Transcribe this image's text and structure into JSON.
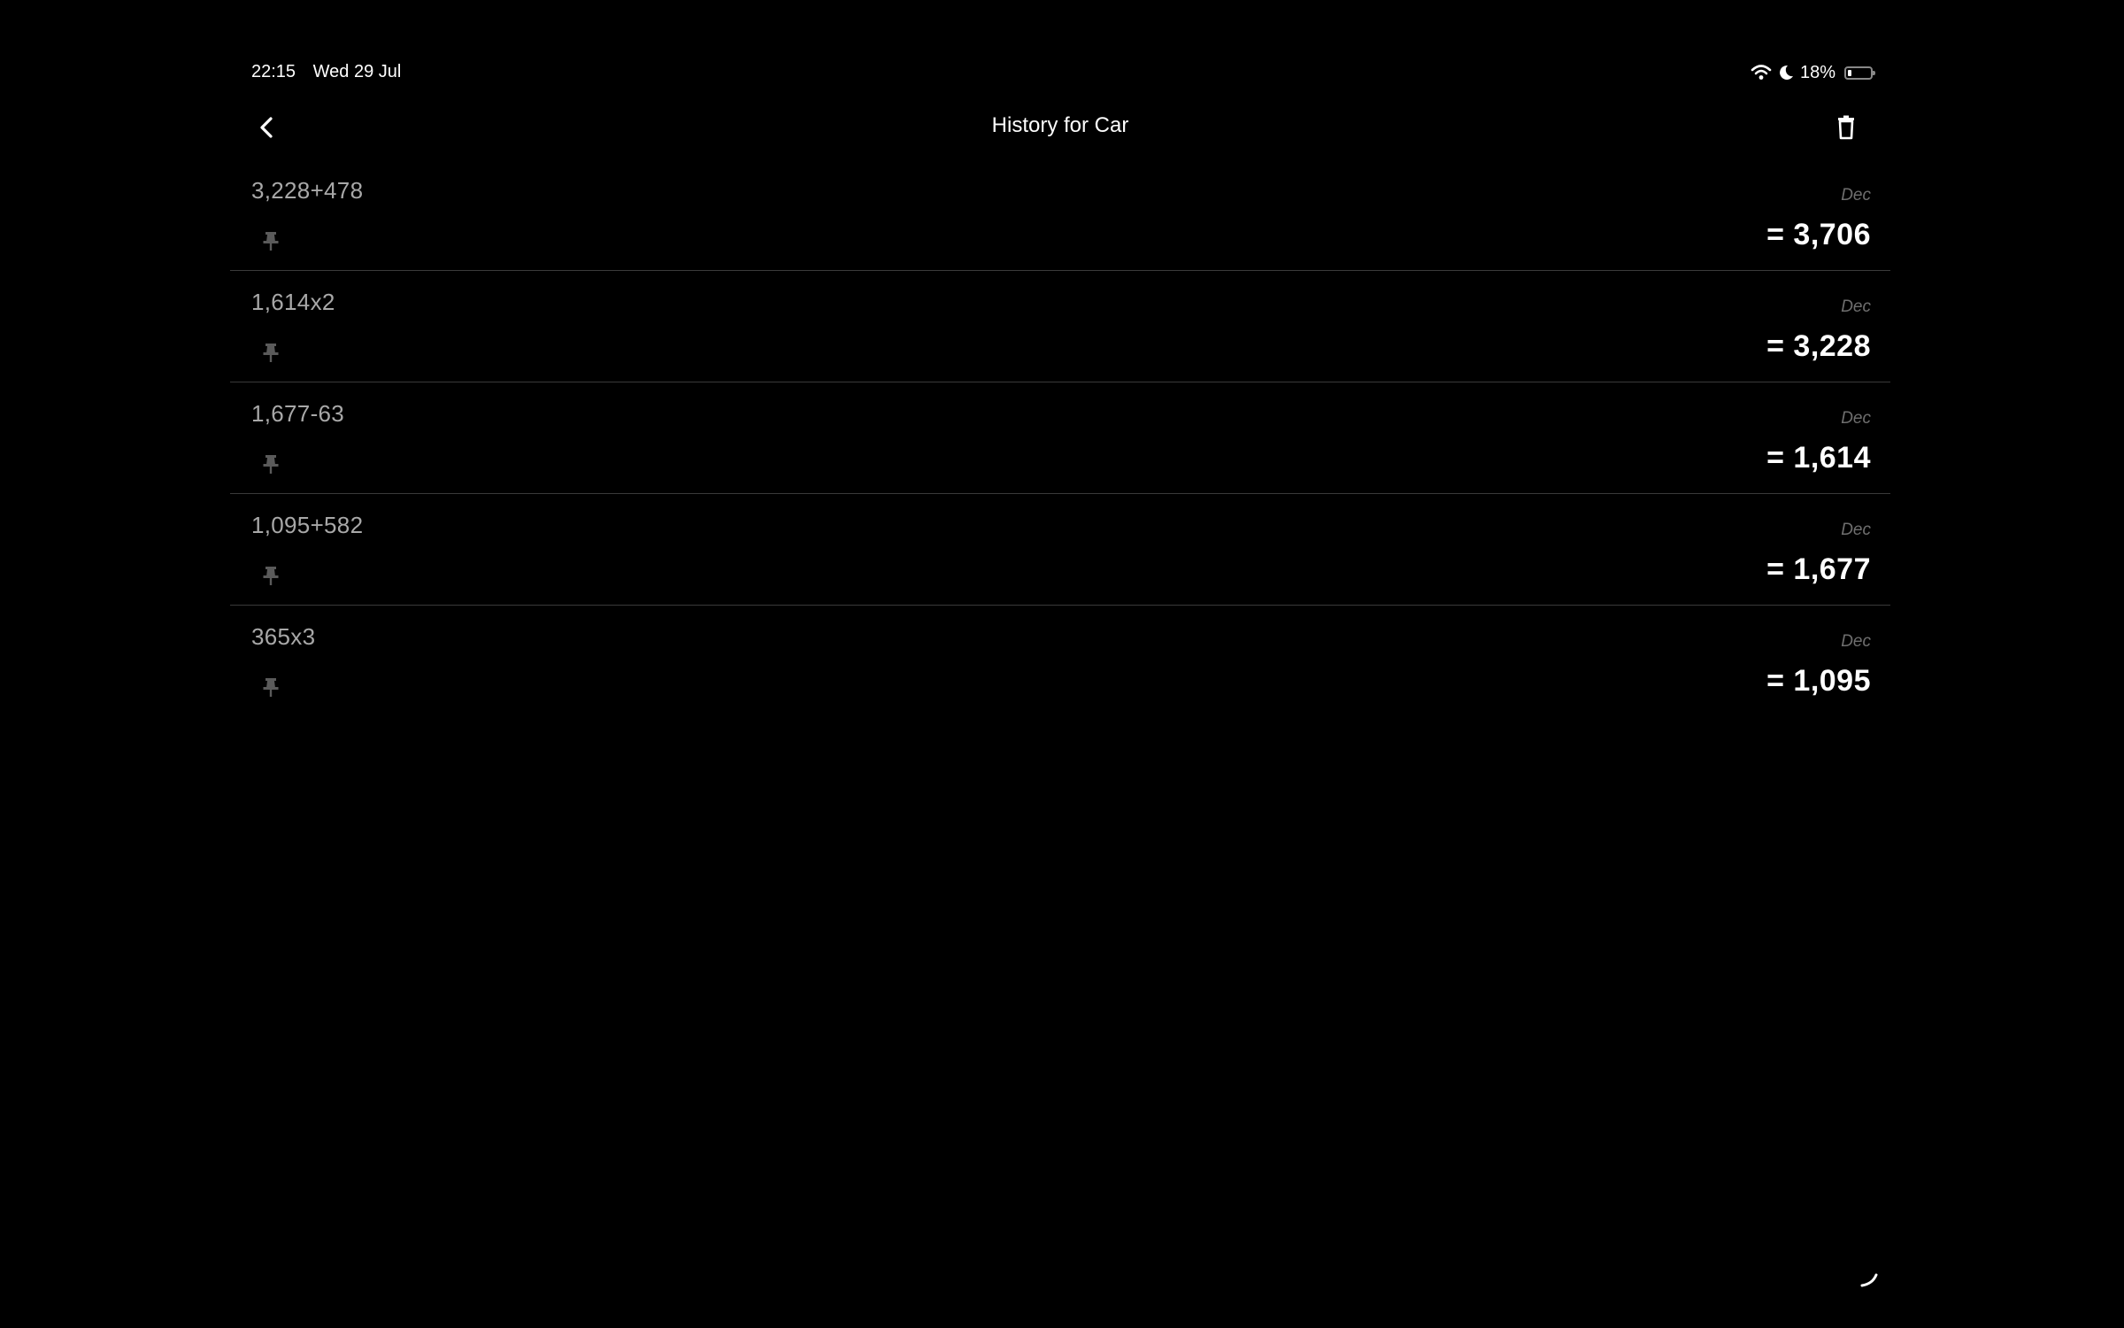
{
  "status_bar": {
    "time": "22:15",
    "date": "Wed 29 Jul",
    "battery_percent": "18%",
    "battery_level": 0.18,
    "icons": [
      "wifi-icon",
      "moon-icon",
      "battery-icon"
    ]
  },
  "nav": {
    "title": "History for Car",
    "back_icon": "chevron-left-icon",
    "delete_icon": "trash-icon"
  },
  "history": [
    {
      "expression": "3,228+478",
      "base": "Dec",
      "result": "= 3,706"
    },
    {
      "expression": "1,614x2",
      "base": "Dec",
      "result": "= 3,228"
    },
    {
      "expression": "1,677-63",
      "base": "Dec",
      "result": "= 1,614"
    },
    {
      "expression": "1,095+582",
      "base": "Dec",
      "result": "= 1,677"
    },
    {
      "expression": "365x3",
      "base": "Dec",
      "result": "= 1,095"
    }
  ],
  "colors": {
    "background": "#000000",
    "expression_text": "#a8a8a8",
    "result_text": "#ffffff",
    "base_label": "#6e6e6e",
    "divider": "#3a3a3a",
    "pin": "#5a5a5a"
  }
}
